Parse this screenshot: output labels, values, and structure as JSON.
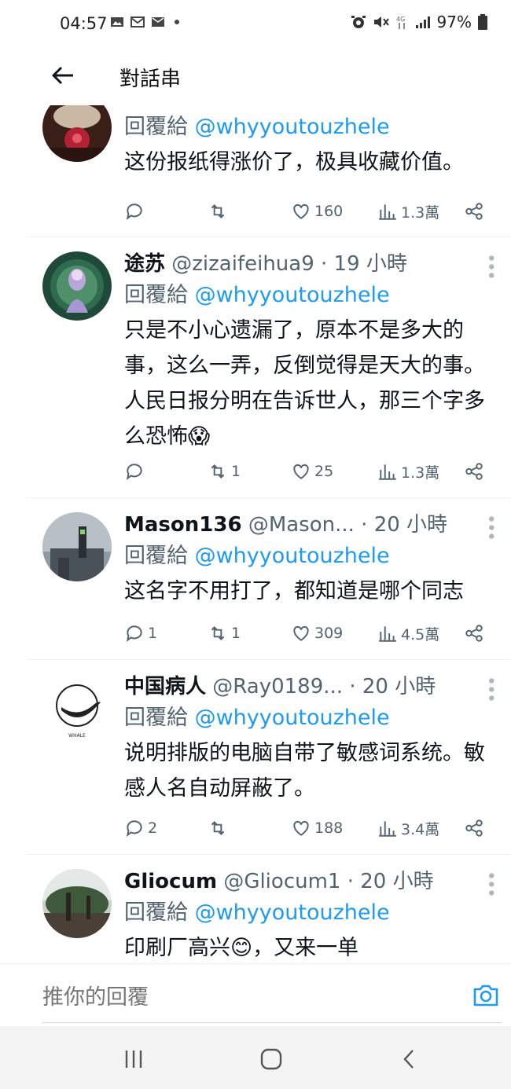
{
  "status_bar": {
    "time": "04:57",
    "battery": "97%"
  },
  "header": {
    "title": "對話串"
  },
  "tweets": [
    {
      "display_name": "",
      "handle": "",
      "time": "",
      "reply_prefix": "回覆給",
      "reply_to": "@whyyoutouzhele",
      "text": "这份报纸得涨价了，极具收藏价值。",
      "replies": "",
      "retweets": "",
      "likes": "160",
      "views": "1.3萬"
    },
    {
      "display_name": "途苏",
      "handle": "@zizaifeihua9",
      "time": "· 19 小時",
      "reply_prefix": "回覆給",
      "reply_to": "@whyyoutouzhele",
      "text": "只是不小心遗漏了，原本不是多大的事，这么一弄，反倒觉得是天大的事。人民日报分明在告诉世人，那三个字多么恐怖😱",
      "replies": "",
      "retweets": "1",
      "likes": "25",
      "views": "1.3萬"
    },
    {
      "display_name": "Mason136",
      "handle": "@Mason...",
      "time": "· 20 小時",
      "reply_prefix": "回覆給",
      "reply_to": "@whyyoutouzhele",
      "text": "这名字不用打了，都知道是哪个同志",
      "replies": "1",
      "retweets": "1",
      "likes": "309",
      "views": "4.5萬"
    },
    {
      "display_name": "中国病人",
      "handle": "@Ray0189...",
      "time": "· 20 小時",
      "reply_prefix": "回覆給",
      "reply_to": "@whyyoutouzhele",
      "text": "说明排版的电脑自带了敏感词系统。敏感人名自动屏蔽了。",
      "replies": "2",
      "retweets": "",
      "likes": "188",
      "views": "3.4萬"
    },
    {
      "display_name": "Gliocum",
      "handle": "@Gliocum1",
      "time": "· 20 小時",
      "reply_prefix": "回覆給",
      "reply_to": "@whyyoutouzhele",
      "text": "印刷厂高兴😊，又来一单",
      "replies": "",
      "retweets": "",
      "likes": "",
      "views": ""
    }
  ],
  "whale_logo_text": "WHALE",
  "reply_bar": {
    "placeholder": "推你的回覆"
  },
  "colors": {
    "link": "#1d9bf0",
    "secondary_text": "#536471",
    "primary_text": "#0f1419",
    "divider": "#eff3f4"
  }
}
